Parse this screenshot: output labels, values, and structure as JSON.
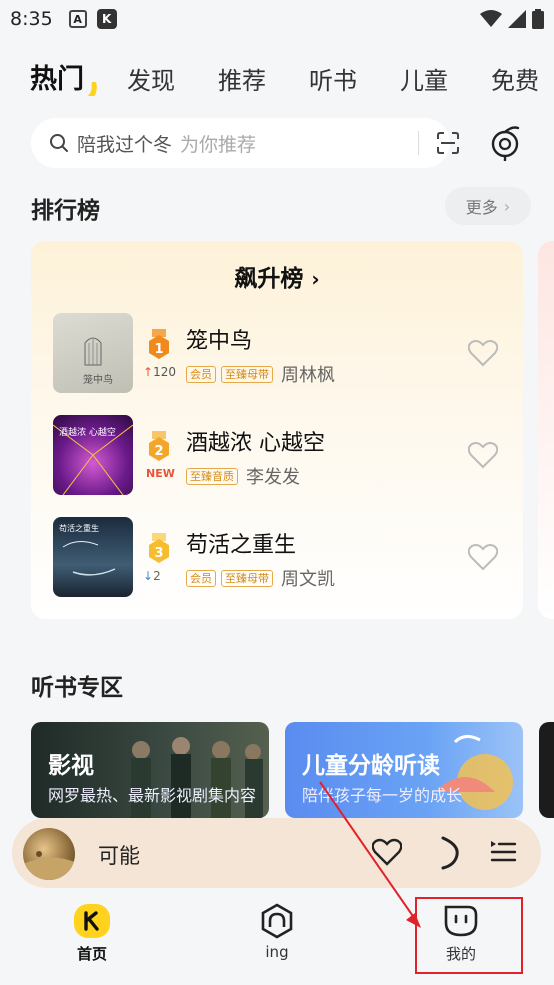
{
  "status_bar": {
    "time": "8:35",
    "icons": [
      "a-icon",
      "app-icon",
      "wifi-icon",
      "signal-icon",
      "battery-icon"
    ]
  },
  "tabs": [
    {
      "label": "热门",
      "active": true
    },
    {
      "label": "发现",
      "active": false
    },
    {
      "label": "推荐",
      "active": false
    },
    {
      "label": "听书",
      "active": false
    },
    {
      "label": "儿童",
      "active": false
    },
    {
      "label": "免费",
      "active": false
    }
  ],
  "search": {
    "value": "陪我过个冬",
    "hint": "为你推荐"
  },
  "ranking": {
    "section_title": "排行榜",
    "more_label": "更多",
    "chart_title": "飙升榜",
    "items": [
      {
        "rank": "1",
        "delta": "120",
        "delta_dir": "up",
        "title": "笼中鸟",
        "badges": [
          "会员",
          "至臻母带"
        ],
        "artist": "周林枫",
        "cover_text": "笼中鸟"
      },
      {
        "rank": "2",
        "delta": "NEW",
        "delta_dir": "new",
        "title": "酒越浓 心越空",
        "badges": [
          "至臻音质"
        ],
        "artist": "李发发",
        "cover_text": "酒越浓 心越空"
      },
      {
        "rank": "3",
        "delta": "2",
        "delta_dir": "down",
        "title": "苟活之重生",
        "badges": [
          "会员",
          "至臻母带"
        ],
        "artist": "周文凯",
        "cover_text": "苟活之重生"
      }
    ]
  },
  "audiobook": {
    "section_title": "听书专区",
    "cards": [
      {
        "title": "影视",
        "subtitle": "网罗最热、最新影视剧集内容"
      },
      {
        "title": "儿童分龄听读",
        "subtitle": "陪伴孩子每一岁的成长"
      }
    ]
  },
  "player": {
    "title": "可能"
  },
  "bottom_nav": [
    {
      "label": "首页",
      "active": true
    },
    {
      "label": "ing",
      "active": false
    },
    {
      "label": "我的",
      "active": false
    }
  ],
  "colors": {
    "accent_yellow": "#ffd21e",
    "badge_orange": "#d58a14",
    "highlight_red": "#e0232b",
    "delta_up": "#e8543b",
    "delta_down": "#3a8bde"
  }
}
